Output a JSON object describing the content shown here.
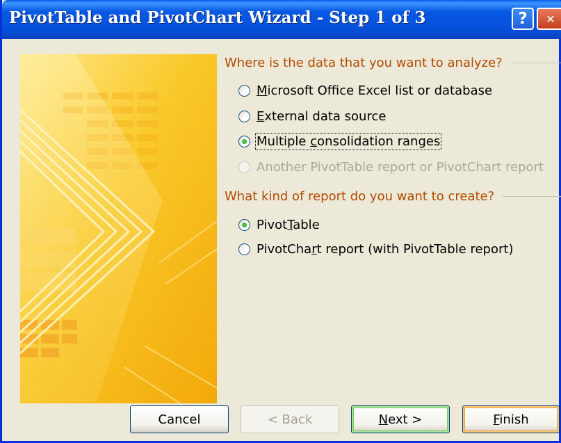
{
  "window": {
    "title": "PivotTable and PivotChart Wizard - Step 1 of 3",
    "help_glyph": "?",
    "close_glyph": "✕"
  },
  "data_section": {
    "label": "Where is the data that you want to analyze?",
    "options": [
      {
        "pre": "",
        "mnemonic": "M",
        "post": "icrosoft Office Excel list or database",
        "checked": false,
        "enabled": true
      },
      {
        "pre": "",
        "mnemonic": "E",
        "post": "xternal data source",
        "checked": false,
        "enabled": true
      },
      {
        "pre": "Multiple ",
        "mnemonic": "c",
        "post": "onsolidation ranges",
        "checked": true,
        "enabled": true
      },
      {
        "pre": "",
        "mnemonic": "",
        "post": "Another PivotTable report or PivotChart report",
        "checked": false,
        "enabled": false
      }
    ]
  },
  "report_section": {
    "label": "What kind of report do you want to create?",
    "options": [
      {
        "pre": "Pivot",
        "mnemonic": "T",
        "post": "able",
        "checked": true,
        "enabled": true
      },
      {
        "pre": "PivotCha",
        "mnemonic": "r",
        "post": "t report (with PivotTable report)",
        "checked": false,
        "enabled": true
      }
    ]
  },
  "buttons": {
    "cancel": {
      "pre": "Cancel",
      "mnemonic": "",
      "post": ""
    },
    "back": {
      "pre": "< Back",
      "mnemonic": "",
      "post": ""
    },
    "next": {
      "pre": "",
      "mnemonic": "N",
      "post": "ext >"
    },
    "finish": {
      "pre": "",
      "mnemonic": "F",
      "post": "inish"
    }
  },
  "colors": {
    "section_label": "#B34A00",
    "title_bar": "#0551DD",
    "graphic_base": "#F7BE14"
  }
}
